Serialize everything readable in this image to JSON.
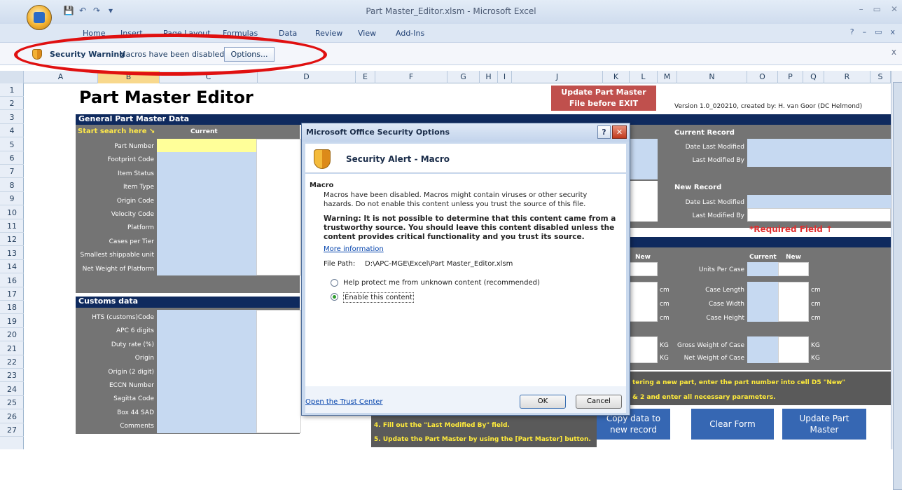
{
  "window": {
    "title": "Part Master_Editor.xlsm - Microsoft Excel",
    "controls": [
      "–",
      "▭",
      "✕"
    ]
  },
  "quick_access": {
    "save_icon": "save-icon",
    "undo_icon": "undo-icon",
    "redo_icon": "redo-icon",
    "customize_icon": "dropdown-icon"
  },
  "ribbon": {
    "tabs": [
      "Home",
      "Insert",
      "Page Layout",
      "Formulas",
      "Data",
      "Review",
      "View",
      "Add-Ins"
    ],
    "right": [
      "?",
      "–",
      "▭",
      "x"
    ]
  },
  "message_bar": {
    "title": "Security Warning",
    "text": "Macros have been disabled.",
    "options_label": "Options...",
    "close": "x"
  },
  "columns": [
    "A",
    "B",
    "C",
    "D",
    "E",
    "F",
    "G",
    "H",
    "I",
    "J",
    "K",
    "L",
    "M",
    "N",
    "O",
    "P",
    "Q",
    "R",
    "S"
  ],
  "rows": [
    "1",
    "2",
    "3",
    "4",
    "5",
    "6",
    "7",
    "8",
    "9",
    "10",
    "11",
    "12",
    "13",
    "14",
    "16",
    "17",
    "18",
    "19",
    "20",
    "21",
    "22",
    "23",
    "24",
    "25",
    "26",
    "27"
  ],
  "sheet": {
    "title": "Part Master Editor",
    "update_warning_l1": "Update Part Master",
    "update_warning_l2": "File before EXIT",
    "version": "Version 1.0_020210, created by: H. van Goor (DC Helmond)",
    "general_header": "General Part Master Data",
    "start_search": "Start search here ↘",
    "current_label": "Current",
    "fields": [
      "Part Number",
      "Footprint Code",
      "Item Status",
      "Item Type",
      "Origin Code",
      "Velocity Code",
      "Platform",
      "Cases per Tier",
      "Smallest shippable unit",
      "Net Weight of Platform"
    ],
    "customs_header": "Customs data",
    "customs_fields": [
      "HTS (customs)Code",
      "APC 6 digits",
      "Duty rate (%)",
      "Origin",
      "Origin (2 digit)",
      "ECCN Number",
      "Sagitta Code",
      "Box 44 SAD",
      "Comments"
    ],
    "current_record_header": "Current Record",
    "current_record_fields": [
      "Date Last Modified",
      "Last Modified By"
    ],
    "new_record_header": "New Record",
    "new_record_fields": [
      "Date Last Modified",
      "Last Modified By"
    ],
    "required": "*Required Field ↑",
    "new_label": "New",
    "current_label2": "Current",
    "new_label2": "New",
    "units_per_case": "Units Per Case",
    "case_length": "Case Length",
    "case_width": "Case Width",
    "case_height": "Case Height",
    "cm": "cm",
    "kg": "KG",
    "gross_weight_case": "Gross Weight of Case",
    "net_weight_case": "Net Weight of Case",
    "instruction_1": "tering a new part, enter the part number into cell D5 \"New\"",
    "instruction_2": "& 2 and enter all necessary parameters.",
    "instruction_4": "4. Fill out the \"Last Modified By\" field.",
    "instruction_5": "5. Update the Part Master by using the [Part Master] button.",
    "btn_copy_l1": "Copy data to",
    "btn_copy_l2": "new record",
    "btn_clear": "Clear Form",
    "btn_update_l1": "Update Part",
    "btn_update_l2": "Master"
  },
  "dialog": {
    "title": "Microsoft Office Security Options",
    "help": "?",
    "close": "✕",
    "heading": "Security Alert - Macro",
    "section": "Macro",
    "desc": "Macros have been disabled. Macros might contain viruses or other security hazards. Do not enable this content unless you trust the source of this file.",
    "warning": "Warning: It is not possible to determine that this content came from a trustworthy source. You should leave this content disabled unless the content provides critical functionality and you trust its source.",
    "more_info": "More information",
    "file_path_label": "File Path:",
    "file_path": "D:\\APC-MGE\\Excel\\Part Master_Editor.xlsm",
    "option_protect": "Help protect me from unknown content (recommended)",
    "option_enable": "Enable this content",
    "selected": "enable",
    "trust_center": "Open the Trust Center",
    "ok": "OK",
    "cancel": "Cancel"
  }
}
